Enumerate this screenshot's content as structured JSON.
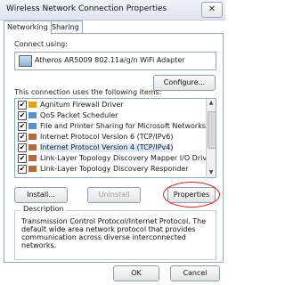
{
  "window": {
    "title": "Wireless Network Connection Properties",
    "close_glyph": "✕"
  },
  "tabs": [
    {
      "label": "Networking"
    },
    {
      "label": "Sharing"
    }
  ],
  "connect_using": {
    "label": "Connect using:",
    "adapter": "Atheros AR5009 802.11a/g/n WiFi Adapter"
  },
  "buttons": {
    "configure": "Configure...",
    "install": "Install...",
    "uninstall": "Uninstall",
    "properties": "Properties",
    "ok": "OK",
    "cancel": "Cancel"
  },
  "items_label": "This connection uses the following items:",
  "items": [
    {
      "label": "Agnitum Firewall Driver",
      "check": "✔"
    },
    {
      "label": "QoS Packet Scheduler",
      "check": "✔"
    },
    {
      "label": "File and Printer Sharing for Microsoft Networks",
      "check": "✔"
    },
    {
      "label": "Internet Protocol Version 6 (TCP/IPv6)",
      "check": "✔"
    },
    {
      "label": "Internet Protocol Version 4 (TCP/IPv4)",
      "check": "✔"
    },
    {
      "label": "Link-Layer Topology Discovery Mapper I/O Driver",
      "check": "✔"
    },
    {
      "label": "Link-Layer Topology Discovery Responder",
      "check": "✔"
    }
  ],
  "description": {
    "title": "Description",
    "text": "Transmission Control Protocol/Internet Protocol. The default wide area network protocol that provides communication across diverse interconnected networks."
  },
  "colors": {
    "annotation": "#d21d1d"
  },
  "icons": {
    "adapter": "network-adapter-icon",
    "item": "network-component-icon",
    "close": "close-icon"
  }
}
